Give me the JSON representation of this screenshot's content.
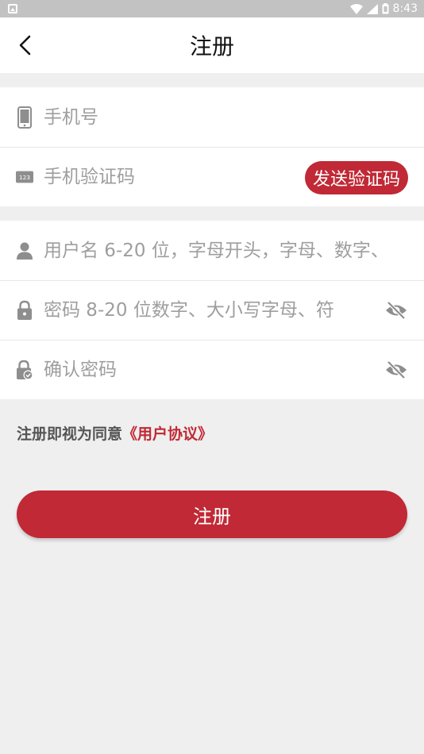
{
  "status_bar": {
    "time": "8:43"
  },
  "header": {
    "title": "注册",
    "back_icon": "chevron-left-icon"
  },
  "phone_group": {
    "phone_placeholder": "手机号",
    "code_placeholder": "手机验证码",
    "send_code_label": "发送验证码"
  },
  "account_group": {
    "username_placeholder": "用户名 6-20 位，字母开头，字母、数字、",
    "password_placeholder": "密码 8-20 位数字、大小写字母、符",
    "confirm_placeholder": "确认密码"
  },
  "agreement": {
    "prefix": "注册即视为同意",
    "link": "《用户协议》"
  },
  "submit": {
    "label": "注册"
  },
  "colors": {
    "accent": "#c02935",
    "background": "#efefef",
    "icon_gray": "#8e8e8e"
  }
}
